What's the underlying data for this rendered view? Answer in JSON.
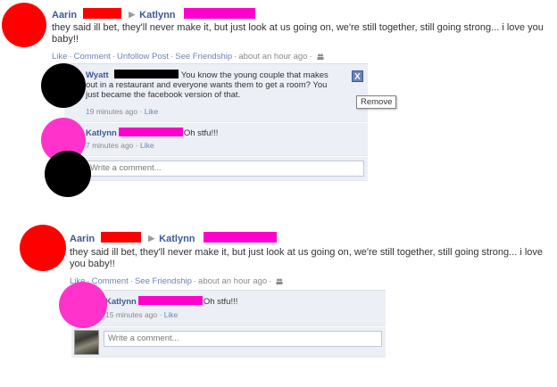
{
  "posts": [
    {
      "author": "Aarin",
      "recipient": "Katlynn",
      "message": "they said ill bet, they'll never make it, but just look at us going on, we're still together, still going strong... i love you baby!!",
      "actions": [
        "Like",
        "Comment",
        "Unfollow Post",
        "See Friendship"
      ],
      "timestamp": "about an hour ago",
      "comments": [
        {
          "author": "Wyatt",
          "text": "You know the young couple that makes out in a restaurant and everyone wants them to get a room? You just became the facebook version of that.",
          "time": "19 minutes ago",
          "like": "Like"
        },
        {
          "author": "Katlynn",
          "text": "Oh stfu!!!",
          "time": "7 minutes ago",
          "like": "Like"
        }
      ],
      "write_placeholder": "Write a comment...",
      "close_label": "X",
      "tooltip": "Remove"
    },
    {
      "author": "Aarin",
      "recipient": "Katlynn",
      "message": "they said ill bet, they'll never make it, but just look at us going on, we're still together, still going strong... i love you baby!!",
      "actions": [
        "Like",
        "Comment",
        "See Friendship"
      ],
      "timestamp": "about an hour ago",
      "comments": [
        {
          "author": "Katlynn",
          "text": "Oh stfu!!!",
          "time": "15 minutes ago",
          "like": "Like"
        }
      ],
      "write_placeholder": "Write a comment..."
    }
  ],
  "colors": {
    "link": "#3b5998",
    "action_link": "#6d84b4",
    "comment_bg": "#eceff5",
    "redact_red": "#ff0000",
    "redact_pink": "#ff00cc",
    "redact_black": "#000000",
    "aarin_avatar": "#ff0000",
    "katlynn_avatar": "#ff33cc",
    "wyatt_avatar": "#000000"
  }
}
